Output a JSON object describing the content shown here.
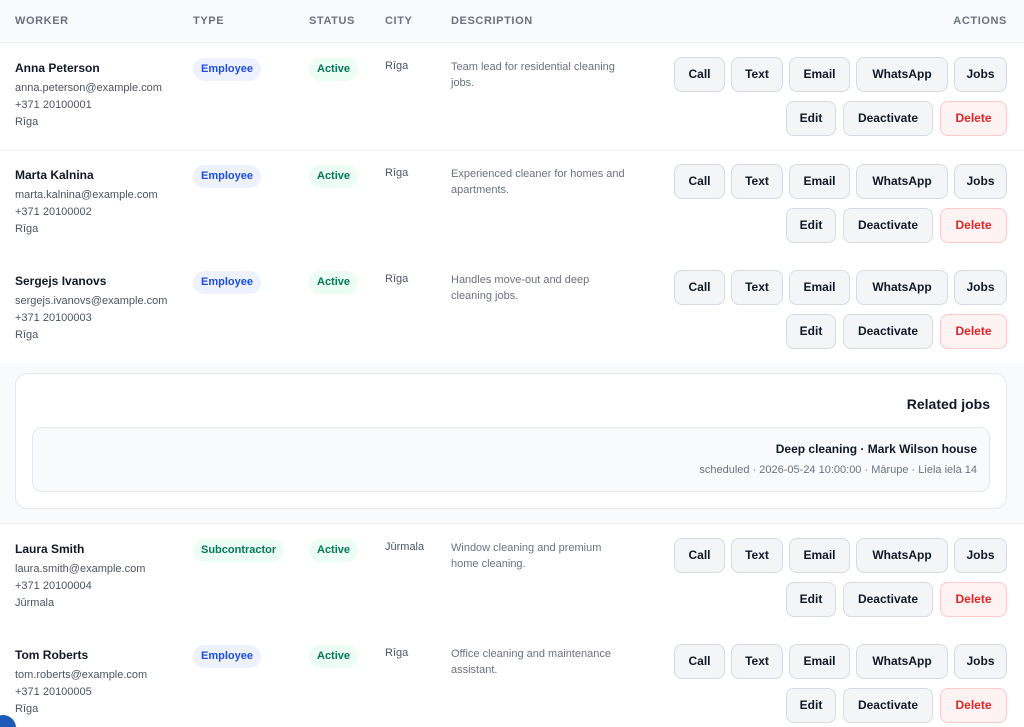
{
  "header": {
    "worker": "WORKER",
    "type": "TYPE",
    "status": "STATUS",
    "city": "CITY",
    "description": "DESCRIPTION",
    "actions": "ACTIONS"
  },
  "actions": {
    "call": "Call",
    "text": "Text",
    "email": "Email",
    "whatsapp": "WhatsApp",
    "jobs": "Jobs",
    "edit": "Edit",
    "deactivate": "Deactivate",
    "delete": "Delete"
  },
  "workers": [
    {
      "name": "Anna Peterson",
      "email": "anna.peterson@example.com",
      "phone": "+371 20100001",
      "location": "Rīga",
      "type": "Employee",
      "status": "Active",
      "city": "Rīga",
      "description": "Team lead for residential cleaning jobs."
    },
    {
      "name": "Marta Kalnina",
      "email": "marta.kalnina@example.com",
      "phone": "+371 20100002",
      "location": "Rīga",
      "type": "Employee",
      "status": "Active",
      "city": "Rīga",
      "description": "Experienced cleaner for homes and apartments."
    },
    {
      "name": "Sergejs Ivanovs",
      "email": "sergejs.ivanovs@example.com",
      "phone": "+371 20100003",
      "location": "Rīga",
      "type": "Employee",
      "status": "Active",
      "city": "Rīga",
      "description": "Handles move-out and deep cleaning jobs."
    },
    {
      "name": "Laura Smith",
      "email": "laura.smith@example.com",
      "phone": "+371 20100004",
      "location": "Jūrmala",
      "type": "Subcontractor",
      "status": "Active",
      "city": "Jūrmala",
      "description": "Window cleaning and premium home cleaning."
    },
    {
      "name": "Tom Roberts",
      "email": "tom.roberts@example.com",
      "phone": "+371 20100005",
      "location": "Rīga",
      "type": "Employee",
      "status": "Active",
      "city": "Rīga",
      "description": "Office cleaning and maintenance assistant."
    }
  ],
  "related": {
    "title": "Related jobs",
    "jobs": [
      {
        "title": "Deep cleaning · Mark Wilson house",
        "meta": "scheduled · 2026-05-24 10:00:00 · Mārupe · Liela iela 14"
      }
    ]
  },
  "colors": {
    "accent_blue": "#1d4ed8",
    "active_green": "#047857",
    "danger_red": "#dc2626"
  }
}
